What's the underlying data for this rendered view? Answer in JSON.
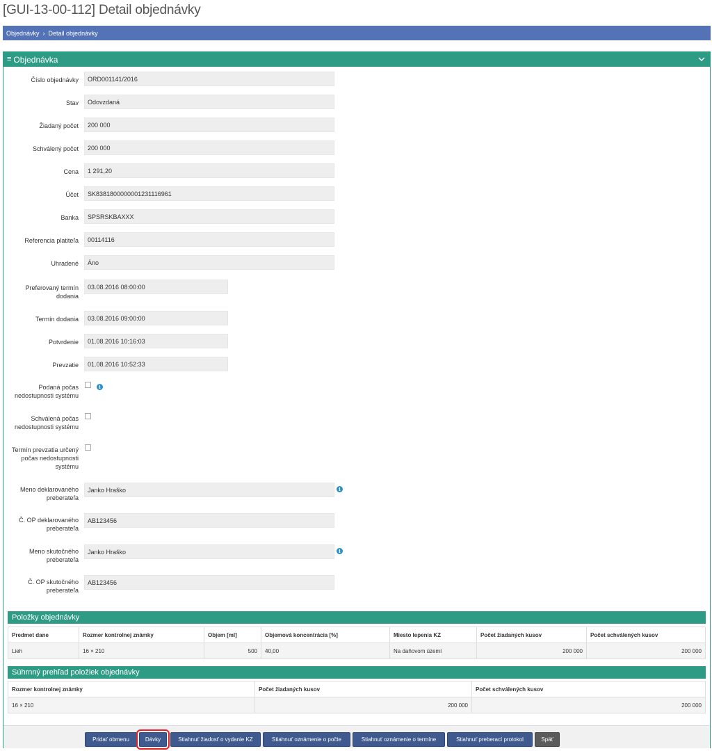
{
  "page": {
    "title": "[GUI-13-00-112] Detail objednávky"
  },
  "breadcrumb": {
    "items": [
      "Objednávky",
      "Detail objednávky"
    ],
    "separator": "›"
  },
  "panel": {
    "title": "Objednávka",
    "fields": [
      {
        "label": "Číslo objednávky",
        "value": "ORD001141/2016"
      },
      {
        "label": "Stav",
        "value": "Odovzdaná"
      },
      {
        "label": "Žiadaný počet",
        "value": "200 000"
      },
      {
        "label": "Schválený počet",
        "value": "200 000"
      },
      {
        "label": "Cena",
        "value": "1 291,20"
      },
      {
        "label": "Účet",
        "value": "SK8381800000001231116961"
      },
      {
        "label": "Banka",
        "value": "SPSRSKBAXXX"
      },
      {
        "label": "Referencia platiteľa",
        "value": "00114116"
      },
      {
        "label": "Uhradené",
        "value": "Áno"
      },
      {
        "label": "Preferovaný termín dodania",
        "value": "03.08.2016 08:00:00"
      },
      {
        "label": "Termín dodania",
        "value": "03.08.2016 09:00:00"
      },
      {
        "label": "Potvrdenie",
        "value": "01.08.2016 10:16:03"
      },
      {
        "label": "Prevzatie",
        "value": "01.08.2016 10:52:33"
      }
    ],
    "checkboxes": [
      {
        "label": "Podaná počas nedostupnosti systému",
        "checked": false
      },
      {
        "label": "Schválená počas nedostupnosti systému",
        "checked": false
      },
      {
        "label": "Termín prevzatia určený počas nedostupnosti systému",
        "checked": false
      }
    ],
    "recipient_fields": [
      {
        "label": "Meno deklarovaného preberateľa",
        "value": "Janko Hraško"
      },
      {
        "label": "Č. OP deklarovaného preberateľa",
        "value": "AB123456"
      },
      {
        "label": "Meno skutočného preberateľa",
        "value": "Janko Hraško"
      },
      {
        "label": "Č. OP skutočného preberateľa",
        "value": "AB123456"
      }
    ]
  },
  "items_section": {
    "title": "Položky objednávky",
    "columns": [
      "Predmet dane",
      "Rozmer kontrolnej známky",
      "Objem [ml]",
      "Objemová koncentrácia [%]",
      "Miesto lepenia KZ",
      "Počet žiadaných kusov",
      "Počet schválených kusov"
    ],
    "rows": [
      [
        "Lieh",
        "16 × 210",
        "500",
        "40,00",
        "Na daňovom území",
        "200 000",
        "200 000"
      ]
    ]
  },
  "summary_section": {
    "title": "Súhrnný prehľad položiek objednávky",
    "columns": [
      "Rozmer kontrolnej známky",
      "Počet žiadaných kusov",
      "Počet schválených kusov"
    ],
    "rows": [
      [
        "16 × 210",
        "200 000",
        "200 000"
      ]
    ]
  },
  "buttons": {
    "add_exchange": "Pridať obmenu",
    "batches": "Dávky",
    "download_request": "Stiahnuť žiadosť o vydanie KZ",
    "download_count_notice": "Stiahnuť oznámenie o počte",
    "download_date_notice": "Stiahnuť oznámenie o termíne",
    "download_protocol": "Stiahnuť preberací protokol",
    "back": "Späť"
  },
  "colors": {
    "breadcrumb_bg": "#5473b6",
    "section_bg": "#2e9b84",
    "button_bg": "#3f5a8f",
    "highlight": "#e41e26"
  }
}
